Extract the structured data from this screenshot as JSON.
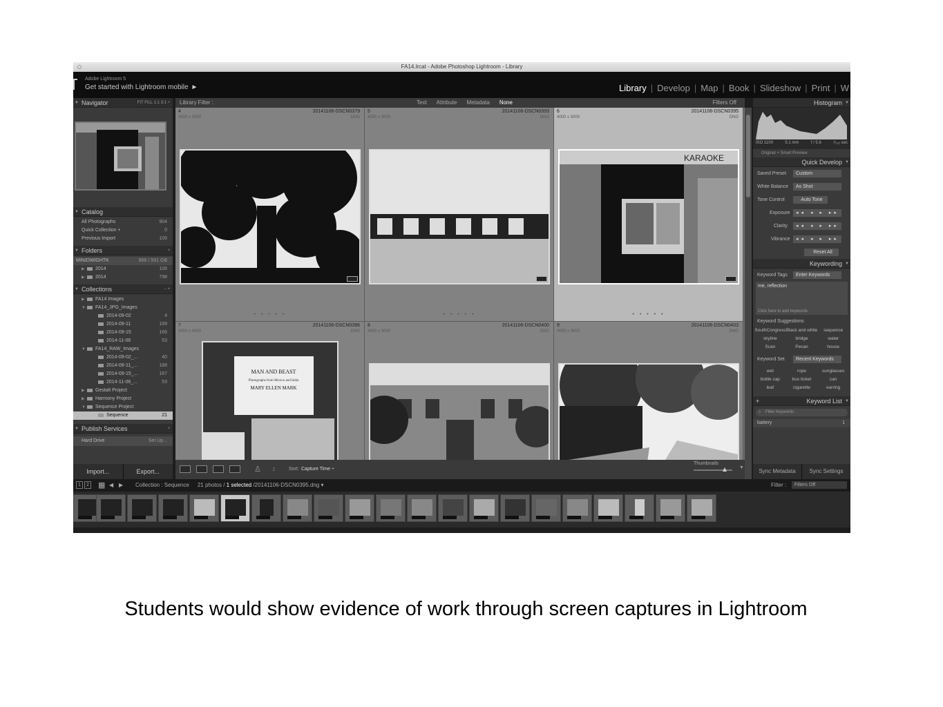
{
  "window": {
    "title": "FA14.lrcat - Adobe Photoshop Lightroom - Library"
  },
  "identity": {
    "small": "Adobe Lightroom 5",
    "big": "Get started with Lightroom mobile",
    "arrow": "►"
  },
  "modules": [
    "Library",
    "Develop",
    "Map",
    "Book",
    "Slideshow",
    "Print",
    "W"
  ],
  "navigator": {
    "title": "Navigator",
    "options": "FIT  FILL  1:1  3:1 ÷"
  },
  "catalog": {
    "title": "Catalog",
    "items": [
      {
        "label": "All Photographs",
        "count": "904"
      },
      {
        "label": "Quick Collection  +",
        "count": "0"
      },
      {
        "label": "Previous Import",
        "count": "106"
      }
    ]
  },
  "folders": {
    "title": "Folders",
    "volume": {
      "label": "MINIDWIGHTK",
      "size": "866 / 931 GB"
    },
    "items": [
      {
        "label": "2014",
        "count": "106"
      },
      {
        "label": "2014",
        "count": "798"
      }
    ]
  },
  "collections": {
    "title": "Collections",
    "items": [
      {
        "label": "FA14 Images",
        "count": ""
      },
      {
        "label": "FA14_JPG_Images",
        "count": ""
      },
      {
        "label": "2014-09-02",
        "count": "4"
      },
      {
        "label": "2014-09-11",
        "count": "189"
      },
      {
        "label": "2014-09-15",
        "count": "166"
      },
      {
        "label": "2014-11-06",
        "count": "53"
      },
      {
        "label": "FA14_RAW_Images",
        "count": ""
      },
      {
        "label": "2014-09-02_...",
        "count": "40"
      },
      {
        "label": "2014-09-11_...",
        "count": "188"
      },
      {
        "label": "2014-09-15_...",
        "count": "167"
      },
      {
        "label": "2014-11-06_...",
        "count": "53"
      },
      {
        "label": "Gestalt Project",
        "count": ""
      },
      {
        "label": "Harmony Project",
        "count": ""
      },
      {
        "label": "Sequence Project",
        "count": ""
      },
      {
        "label": "Sequence",
        "count": "21"
      }
    ]
  },
  "publish": {
    "title": "Publish Services",
    "item": "Hard Drive",
    "setup": "Set Up..."
  },
  "buttons": {
    "import": "Import...",
    "export": "Export..."
  },
  "filter": {
    "title": "Library Filter :",
    "options": [
      "Text",
      "Attribute",
      "Metadata",
      "None"
    ],
    "status": "Filters Off"
  },
  "grid": [
    {
      "num": "4",
      "file": "20141106-DSCN0379",
      "dim": "4000 x 3000",
      "type": "DNG"
    },
    {
      "num": "5",
      "file": "20141106-DSCN0393",
      "dim": "4000 x 3000",
      "type": "DNG"
    },
    {
      "num": "6",
      "file": "20141106-DSCN0395",
      "dim": "4000 x 3000",
      "type": "DNG"
    },
    {
      "num": "7",
      "file": "20141106-DSCN0396",
      "dim": "3000 x 4000",
      "type": "DNG"
    },
    {
      "num": "8",
      "file": "20141106-DSCN0400",
      "dim": "4000 x 3000",
      "type": "DNG"
    },
    {
      "num": "9",
      "file": "20141106-DSCN0403",
      "dim": "4000 x 3000",
      "type": "DNG"
    }
  ],
  "book_cover": {
    "title": "MAN AND BEAST",
    "subtitle": "Photographs from Mexico and India",
    "author": "MARY ELLEN MARK"
  },
  "karaoke_sign": "KARAOKE",
  "toolbar": {
    "sort_label": "Sort:",
    "sort_value": "Capture Time ÷",
    "thumbnails": "Thumbnails"
  },
  "histogram": {
    "title": "Histogram",
    "iso": "ISO 1100",
    "focal": "5.1 mm",
    "aperture": "f / 5.6",
    "shutter": "¹⁄₁₂₅ sec",
    "preview": "Original + Smart Preview"
  },
  "quick_develop": {
    "title": "Quick Develop",
    "saved_preset": {
      "label": "Saved Preset",
      "value": "Custom"
    },
    "white_balance": {
      "label": "White Balance",
      "value": "As Shot"
    },
    "tone_control": {
      "label": "Tone Control",
      "value": "Auto Tone"
    },
    "exposure": "Exposure",
    "clarity": "Clarity",
    "vibrance": "Vibrance",
    "reset": "Reset All"
  },
  "keywording": {
    "title": "Keywording",
    "tags_label": "Keyword Tags",
    "tags_value": "Enter Keywords",
    "keywords": "me, reflection",
    "add_placeholder": "Click here to add keywords",
    "suggestions_title": "Keyword Suggestions",
    "suggestions": [
      "SouthCongress",
      "Black and white",
      "sequence",
      "skyline",
      "bridge",
      "water",
      "Scan",
      "Pecan",
      "house"
    ],
    "set_label": "Keyword Set",
    "set_value": "Recent Keywords",
    "set_items": [
      "wet",
      "rope",
      "sunglasses",
      "bottle cap",
      "bus ticket",
      "can",
      "leaf",
      "cigarette",
      "earring"
    ]
  },
  "keyword_list": {
    "title": "Keyword List",
    "filter_placeholder": "Filter Keywords",
    "first_item": "battery",
    "first_count": "1"
  },
  "sync": {
    "metadata": "Sync Metadata",
    "settings": "Sync Settings"
  },
  "filmbar": {
    "screen1": "1",
    "screen2": "2",
    "collection": "Collection : Sequence",
    "photos": "21 photos / ",
    "selected": "1 selected",
    "file": " /20141106-DSCN0395.dng ▾",
    "filter_label": "Filter :",
    "filter_value": "Filters Off"
  },
  "caption": "Students would show evidence of work through  screen captures in Lightroom"
}
